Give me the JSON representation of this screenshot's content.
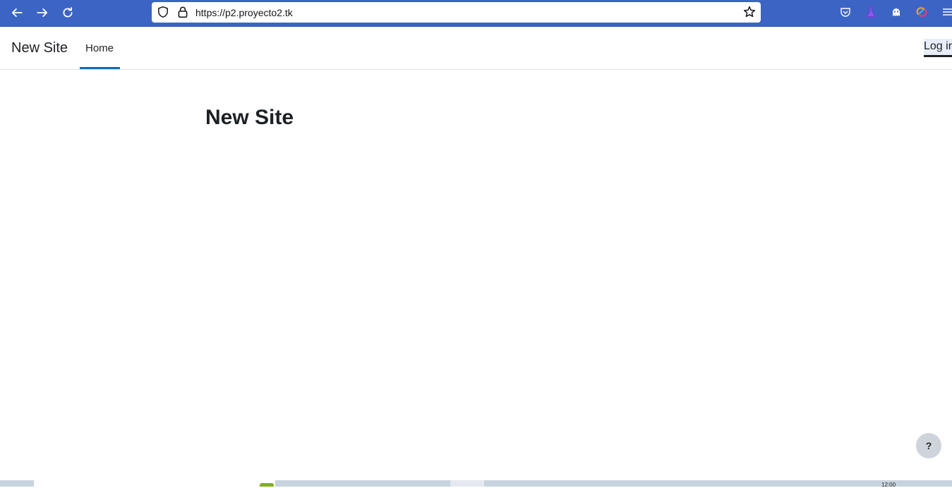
{
  "browser": {
    "url": "https://p2.proyecto2.tk",
    "accent_color": "#3c64c4"
  },
  "navbar": {
    "brand": "New Site",
    "items": [
      {
        "label": "Home",
        "active": true
      }
    ],
    "login_label": "Log in"
  },
  "main": {
    "heading": "New Site"
  },
  "help": {
    "label": "?"
  },
  "taskbar": {
    "clock": "12:00"
  },
  "colors": {
    "active_tab_underline": "#0f6cbf",
    "text": "#1d2125"
  }
}
